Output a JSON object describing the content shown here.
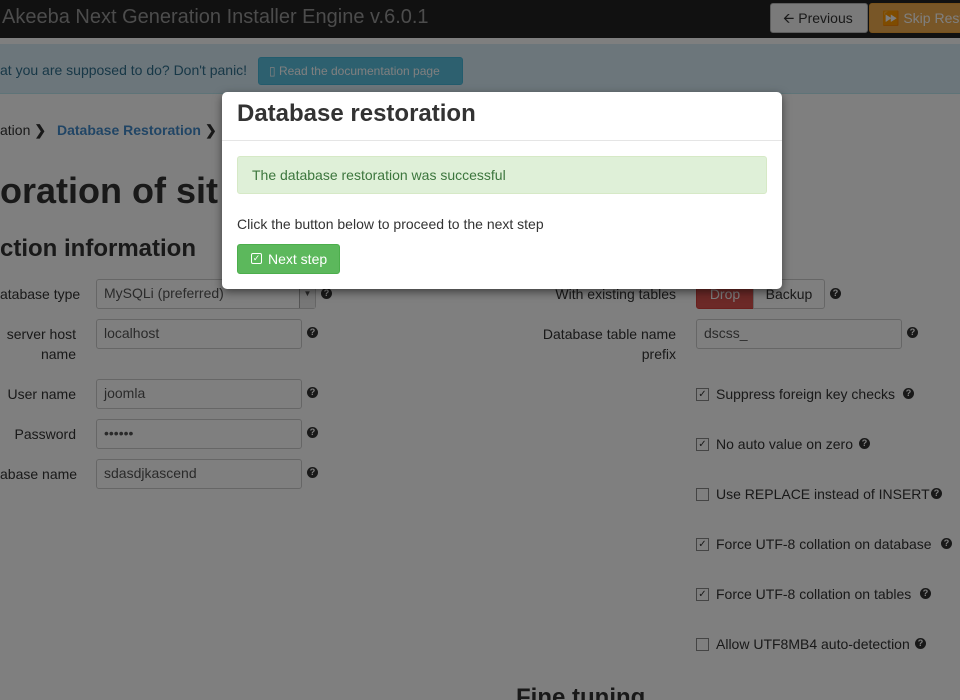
{
  "navbar": {
    "title": "Akeeba Next Generation Installer Engine v.6.0.1",
    "previous_label": "Previous",
    "skip_label": "Skip Resto"
  },
  "infobar": {
    "text": "at you are supposed to do? Don't panic!",
    "docs_label": "Read the documentation page"
  },
  "breadcrumb": {
    "items": [
      "ation",
      "Database Restoration"
    ]
  },
  "page": {
    "heading": "oration of sit",
    "section_heading": "ction information",
    "fine_tuning_heading": "Fine tuning"
  },
  "form_left": {
    "db_type_label": "atabase type",
    "db_type_value": "MySQLi (preferred)",
    "host_label": "server host\nname",
    "host_value": "localhost",
    "user_label": "User name",
    "user_value": "joomla",
    "password_label": "Password",
    "password_value": "••••••",
    "dbname_label": "abase name",
    "dbname_value": "sdasdjkascend"
  },
  "form_right": {
    "existing_tables_label": "With existing tables",
    "drop_label": "Drop",
    "backup_label": "Backup",
    "prefix_label": "Database table name\nprefix",
    "prefix_value": "dscss_",
    "checkboxes": [
      {
        "label": "Suppress foreign key checks",
        "checked": true
      },
      {
        "label": "No auto value on zero",
        "checked": true
      },
      {
        "label": "Use REPLACE instead of INSERT",
        "checked": false
      },
      {
        "label": "Force UTF-8 collation on database",
        "checked": true
      },
      {
        "label": "Force UTF-8 collation on tables",
        "checked": true
      },
      {
        "label": "Allow UTF8MB4 auto-detection",
        "checked": false
      }
    ]
  },
  "modal": {
    "title": "Database restoration",
    "success_message": "The database restoration was successful",
    "instruction": "Click the button below to proceed to the next step",
    "next_label": "Next step"
  },
  "icons": {
    "previous": "arrow-left-icon",
    "skip": "fast-forward-icon",
    "docs": "book-icon",
    "breadcrumb_sep": "chevron-right-icon",
    "help": "question-circle-icon",
    "next": "check-square-icon"
  }
}
